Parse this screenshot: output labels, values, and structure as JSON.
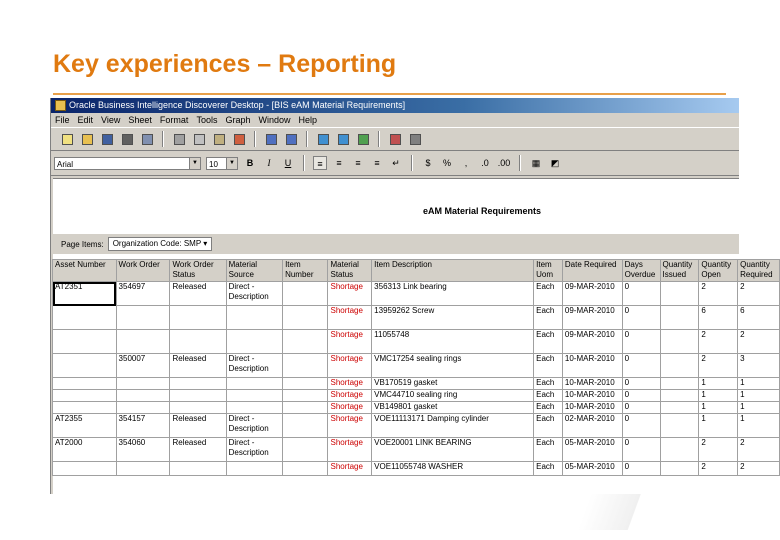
{
  "slide": {
    "title": "Key experiences – Reporting"
  },
  "window": {
    "title": "Oracle Business Intelligence Discoverer Desktop - [BIS eAM Material Requirements]"
  },
  "menu": [
    "File",
    "Edit",
    "View",
    "Sheet",
    "Format",
    "Tools",
    "Graph",
    "Window",
    "Help"
  ],
  "toolbar": {
    "icons": [
      "new-workbook-icon",
      "open-icon",
      "save-icon",
      "print-icon",
      "print-preview-icon",
      "cut-icon",
      "copy-icon",
      "paste-icon",
      "wizard-icon",
      "undo-icon",
      "redo-icon",
      "sort-ascending-icon",
      "sort-descending-icon",
      "drill-icon",
      "graph-icon",
      "calculator-icon"
    ]
  },
  "format": {
    "font": "Arial",
    "size": "10",
    "bold": "B",
    "italic": "I",
    "underline": "U"
  },
  "report": {
    "title": "eAM Material Requirements",
    "page_items_label": "Page Items:",
    "page_items_value": "Organization Code: SMP",
    "columns": [
      "Asset Number",
      "Work Order",
      "Work Order Status",
      "Material Source",
      "Item Number",
      "Material Status",
      "Item Description",
      "Item Uom",
      "Date Required",
      "Days Overdue",
      "Quantity Issued",
      "Quantity Open",
      "Quantity Required"
    ],
    "rows": [
      [
        "AT2351",
        "354697",
        "Released",
        "Direct - Description",
        "",
        "Shortage",
        "356313 Link bearing",
        "Each",
        "09-MAR-2010",
        "0",
        "2",
        "2"
      ],
      [
        "",
        "",
        "",
        "",
        "",
        "Shortage",
        "13959262 Screw",
        "Each",
        "09-MAR-2010",
        "0",
        "6",
        "6"
      ],
      [
        "",
        "",
        "",
        "",
        "",
        "Shortage",
        "11055748",
        "Each",
        "09-MAR-2010",
        "0",
        "2",
        "2"
      ],
      [
        "",
        "350007",
        "Released",
        "Direct - Description",
        "",
        "Shortage",
        "VMC17254 sealing rings",
        "Each",
        "10-MAR-2010",
        "0",
        "2",
        "3"
      ],
      [
        "",
        "",
        "",
        "",
        "",
        "Shortage",
        "VB170519 gasket",
        "Each",
        "10-MAR-2010",
        "0",
        "1",
        "1"
      ],
      [
        "",
        "",
        "",
        "",
        "",
        "Shortage",
        "VMC44710 sealing ring",
        "Each",
        "10-MAR-2010",
        "0",
        "1",
        "1"
      ],
      [
        "",
        "",
        "",
        "",
        "",
        "Shortage",
        "VB149801 gasket",
        "Each",
        "10-MAR-2010",
        "0",
        "1",
        "1"
      ],
      [
        "AT2355",
        "354157",
        "Released",
        "Direct - Description",
        "",
        "Shortage",
        "VOE11113171 Damping cylinder",
        "Each",
        "02-MAR-2010",
        "0",
        "1",
        "1"
      ],
      [
        "AT2000",
        "354060",
        "Released",
        "Direct - Description",
        "",
        "Shortage",
        "VOE20001 LINK BEARING",
        "Each",
        "05-MAR-2010",
        "0",
        "2",
        "2"
      ],
      [
        "",
        "",
        "",
        "",
        "",
        "Shortage",
        "VOE11055748 WASHER",
        "Each",
        "05-MAR-2010",
        "0",
        "2",
        "2"
      ]
    ]
  }
}
